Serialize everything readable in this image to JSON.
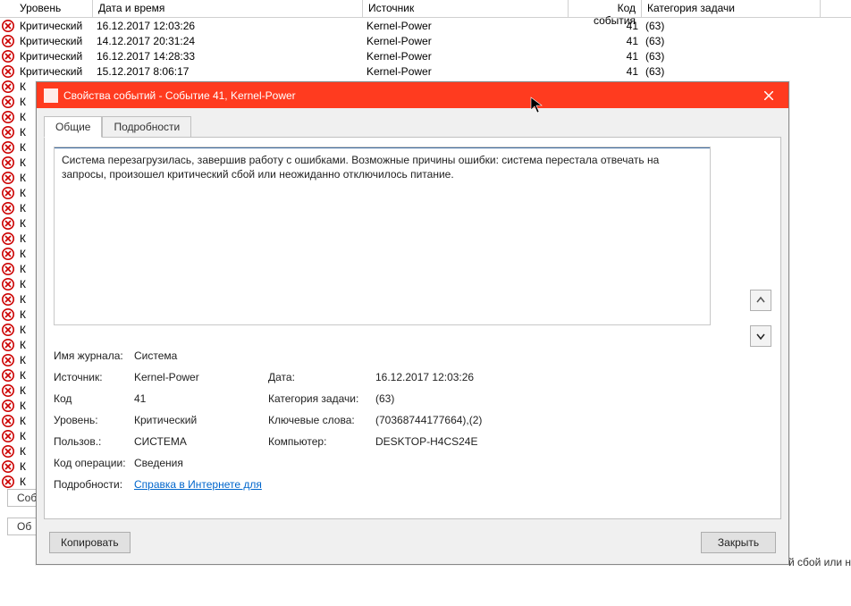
{
  "listHeaders": {
    "level": "Уровень",
    "date": "Дата и время",
    "source": "Источник",
    "eventId": "Код события",
    "category": "Категория задачи"
  },
  "rows": [
    {
      "level": "Критический",
      "date": "16.12.2017 12:03:26",
      "source": "Kernel-Power",
      "eventId": "41",
      "category": "(63)"
    },
    {
      "level": "Критический",
      "date": "14.12.2017 20:31:24",
      "source": "Kernel-Power",
      "eventId": "41",
      "category": "(63)"
    },
    {
      "level": "Критический",
      "date": "16.12.2017 14:28:33",
      "source": "Kernel-Power",
      "eventId": "41",
      "category": "(63)"
    },
    {
      "level": "Критический",
      "date": "15.12.2017 8:06:17",
      "source": "Kernel-Power",
      "eventId": "41",
      "category": "(63)"
    }
  ],
  "partialLevel": "К",
  "backTab1": "Соб",
  "backTab2": "Об",
  "backPanelText": "й сбой или н",
  "dialog": {
    "title": "Свойства событий - Событие 41, Kernel-Power",
    "tabs": {
      "general": "Общие",
      "details": "Подробности"
    },
    "description": "Система перезагрузилась, завершив работу с ошибками. Возможные причины ошибки: система перестала отвечать на запросы, произошел критический сбой или неожиданно отключилось питание.",
    "labels": {
      "log": "Имя журнала:",
      "source": "Источник:",
      "code": "Код",
      "level": "Уровень:",
      "user": "Пользов.:",
      "opcode": "Код операции:",
      "more": "Подробности:",
      "date": "Дата:",
      "category": "Категория задачи:",
      "keywords": "Ключевые слова:",
      "computer": "Компьютер:"
    },
    "values": {
      "log": "Система",
      "source": "Kernel-Power",
      "code": "41",
      "level": "Критический",
      "user": "СИСТЕМА",
      "opcode": "Сведения",
      "date": "16.12.2017 12:03:26",
      "category": "(63)",
      "keywords": "(70368744177664),(2)",
      "computer": "DESKTOP-H4CS24E"
    },
    "helpLink": "Справка в Интернете для ",
    "copy": "Копировать",
    "close": "Закрыть"
  }
}
